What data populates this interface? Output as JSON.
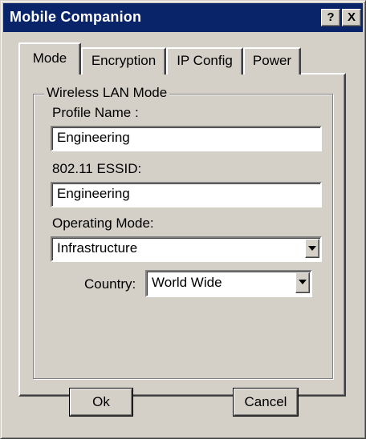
{
  "window": {
    "title": "Mobile Companion",
    "help_button": "?",
    "close_button": "X"
  },
  "tabs": [
    {
      "label": "Mode",
      "active": true
    },
    {
      "label": "Encryption",
      "active": false
    },
    {
      "label": "IP Config",
      "active": false
    },
    {
      "label": "Power",
      "active": false
    }
  ],
  "group": {
    "title": "Wireless LAN Mode"
  },
  "profile": {
    "label": "Profile Name :",
    "value": "Engineering"
  },
  "essid": {
    "label": "802.11 ESSID:",
    "value": "Engineering"
  },
  "operating_mode": {
    "label": "Operating Mode:",
    "value": "Infrastructure"
  },
  "country": {
    "label": "Country:",
    "value": "World Wide"
  },
  "buttons": {
    "ok": "Ok",
    "cancel": "Cancel"
  },
  "colors": {
    "titlebar": "#0a246a",
    "face": "#d4d0c8"
  }
}
